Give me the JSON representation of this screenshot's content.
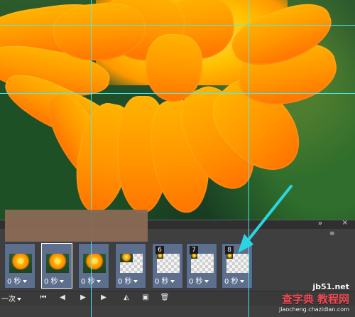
{
  "frames": [
    {
      "number": "",
      "time": "0 秒"
    },
    {
      "number": "",
      "time": "0 秒"
    },
    {
      "number": "",
      "time": "0 秒"
    },
    {
      "number": "",
      "time": "0 秒"
    },
    {
      "number": "6",
      "time": "0 秒"
    },
    {
      "number": "7",
      "time": "0 秒"
    },
    {
      "number": "8",
      "time": "0 秒"
    }
  ],
  "controls": {
    "loop_label": "一次"
  },
  "watermark": {
    "site": "jb51.net",
    "brand": "教程网",
    "url": "jiaocheng.chazidian.com",
    "prefix": "查字典"
  },
  "colors": {
    "guides": "#40f2f6",
    "frame_bg": "#5d6f8c",
    "arrow": "#2bd6e3"
  },
  "icons": {
    "panel_expand": "double-chevron-icon",
    "panel_menu": "menu-icon",
    "first_frame": "first-frame-icon",
    "previous_frame": "previous-frame-icon",
    "play": "play-icon",
    "next_frame": "next-frame-icon",
    "tween": "tween-icon",
    "duplicate": "duplicate-frame-icon",
    "delete": "trash-icon"
  }
}
